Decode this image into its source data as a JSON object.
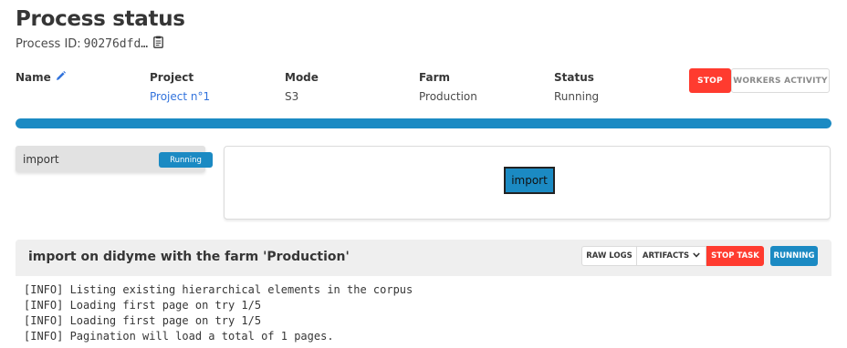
{
  "page": {
    "title": "Process status",
    "process_id_label": "Process ID:",
    "process_id_value": "90276dfd…"
  },
  "fields": [
    {
      "label": "Name",
      "value": ""
    },
    {
      "label": "Project",
      "value": "Project n°1"
    },
    {
      "label": "Mode",
      "value": "S3"
    },
    {
      "label": "Farm",
      "value": "Production"
    },
    {
      "label": "Status",
      "value": "Running"
    }
  ],
  "actions": {
    "stop_label": "STOP",
    "workers_label": "WORKERS ACTIVITY"
  },
  "progress": {
    "fraction": 1.0
  },
  "tasks": [
    {
      "name": "import",
      "status": "Running"
    }
  ],
  "graph": {
    "nodes": [
      "import"
    ]
  },
  "task_panel": {
    "title": "import on didyme with the farm 'Production'",
    "raw_logs_label": "RAW LOGS",
    "artifacts_label": "ARTIFACTS",
    "stop_task_label": "STOP TASK",
    "status_label": "RUNNING"
  },
  "logs": [
    "[INFO] Listing existing hierarchical elements in the corpus",
    "[INFO] Loading first page on try 1/5",
    "[INFO] Loading first page on try 1/5",
    "[INFO] Pagination will load a total of 1 pages."
  ],
  "colors": {
    "accent_blue": "#1b8ac3",
    "danger_red": "#ff3b2f",
    "link_blue": "#3273dc"
  },
  "icons": {
    "clipboard": "clipboard-icon",
    "pencil": "pencil-icon",
    "chevron": "chevron-down-icon"
  }
}
